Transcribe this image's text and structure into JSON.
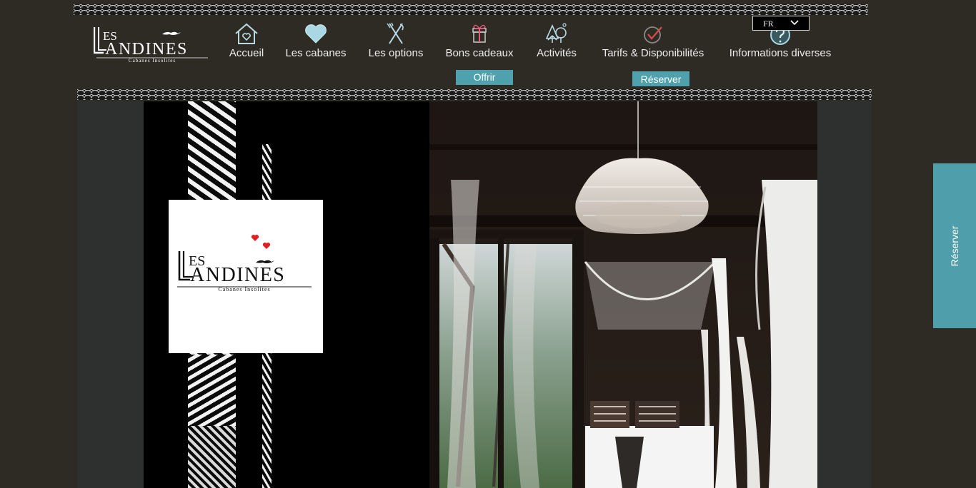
{
  "brand": {
    "name_prefix": "ES",
    "name": "ANDINES",
    "tagline": "Cabanes Insolites"
  },
  "nav": {
    "items": [
      {
        "label": "Accueil",
        "icon": "house-heart-icon"
      },
      {
        "label": "Les cabanes",
        "icon": "heart-icon"
      },
      {
        "label": "Les options",
        "icon": "fork-knife-icon"
      },
      {
        "label": "Bons cadeaux",
        "icon": "gift-icon"
      },
      {
        "label": "Activités",
        "icon": "trees-icon"
      },
      {
        "label": "Tarifs & Disponibilités",
        "icon": "check-circle-icon"
      },
      {
        "label": "Informations diverses",
        "icon": "question-icon"
      }
    ],
    "offrir_label": "Offrir",
    "reserver_label": "Réserver"
  },
  "language": {
    "selected": "FR"
  },
  "side_cta": {
    "label": "Réserver"
  },
  "colors": {
    "background": "#2e2b25",
    "accent": "#4fa1ad",
    "heart": "#e02020"
  }
}
